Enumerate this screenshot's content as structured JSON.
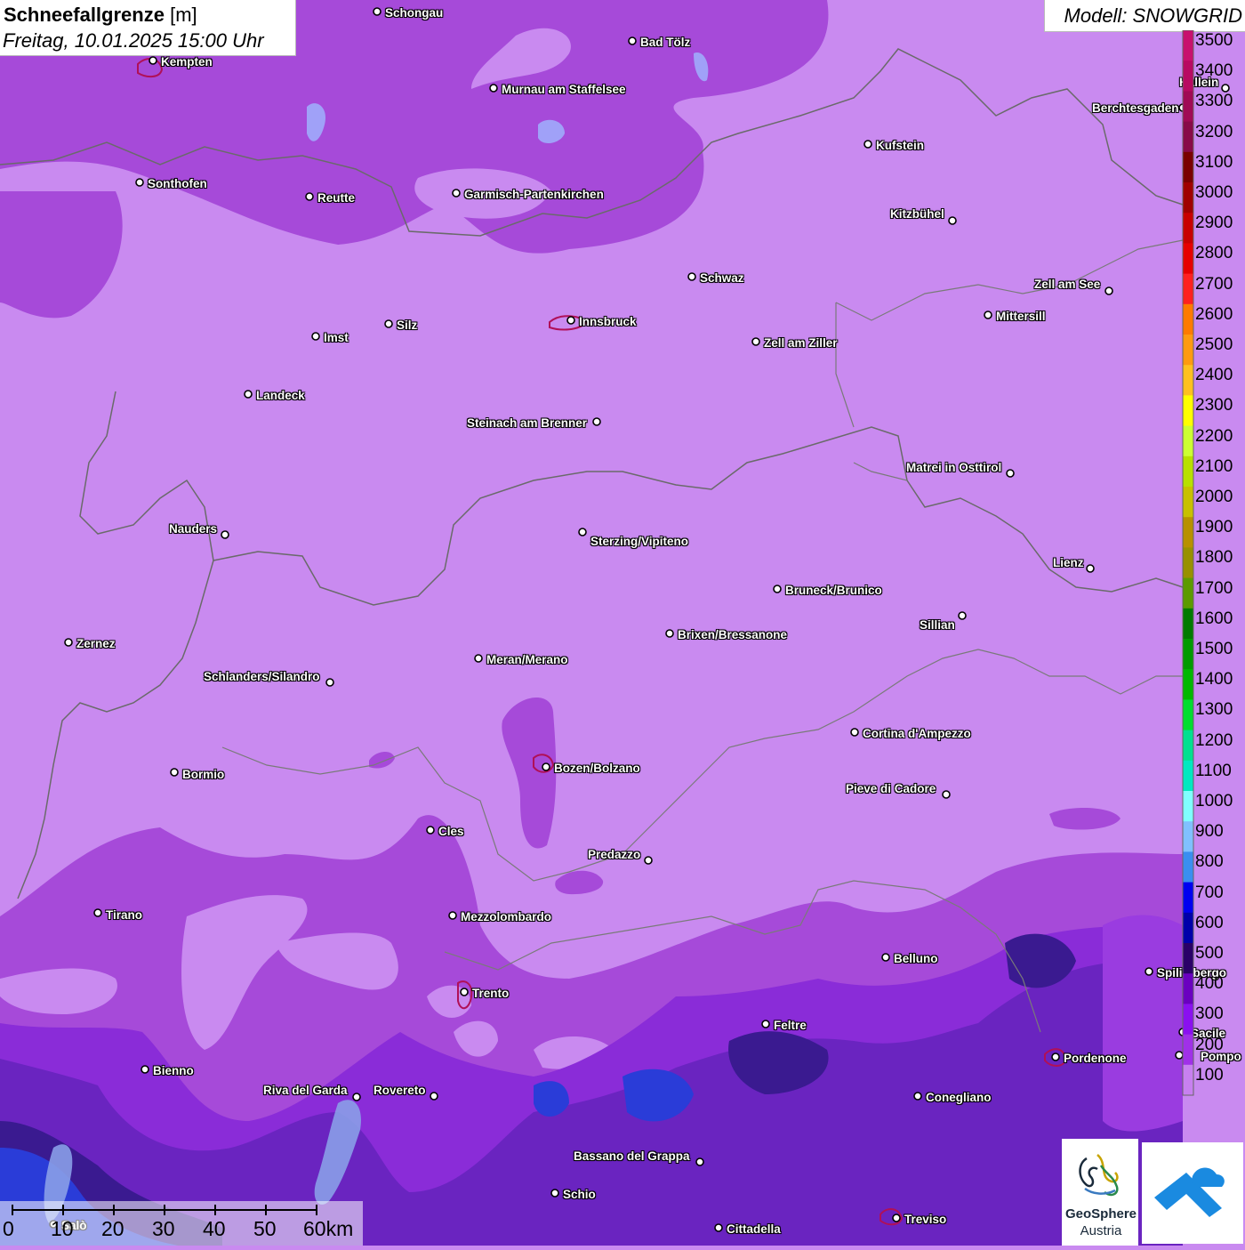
{
  "header": {
    "title": "Schneefallgrenze",
    "unit": "[m]",
    "datetime": "Freitag, 10.01.2025 15:00 Uhr",
    "model": "Modell: SNOWGRID"
  },
  "legend": {
    "levels": [
      {
        "value": "3500",
        "color": "#c8106e"
      },
      {
        "value": "3400",
        "color": "#b80a62"
      },
      {
        "value": "3300",
        "color": "#a00a55"
      },
      {
        "value": "3200",
        "color": "#880a48"
      },
      {
        "value": "3100",
        "color": "#7a0000"
      },
      {
        "value": "3000",
        "color": "#a00000"
      },
      {
        "value": "2900",
        "color": "#c80000"
      },
      {
        "value": "2800",
        "color": "#e60000"
      },
      {
        "value": "2700",
        "color": "#ff2020"
      },
      {
        "value": "2600",
        "color": "#ff7a00"
      },
      {
        "value": "2500",
        "color": "#ff9a10"
      },
      {
        "value": "2400",
        "color": "#ffc020"
      },
      {
        "value": "2300",
        "color": "#ffff00"
      },
      {
        "value": "2200",
        "color": "#ccff33"
      },
      {
        "value": "2100",
        "color": "#b8e000"
      },
      {
        "value": "2000",
        "color": "#c8c000"
      },
      {
        "value": "1900",
        "color": "#b89000"
      },
      {
        "value": "1800",
        "color": "#989000"
      },
      {
        "value": "1700",
        "color": "#5c9a00"
      },
      {
        "value": "1600",
        "color": "#007a00"
      },
      {
        "value": "1500",
        "color": "#009a00"
      },
      {
        "value": "1400",
        "color": "#00b800"
      },
      {
        "value": "1300",
        "color": "#00dd30"
      },
      {
        "value": "1200",
        "color": "#00e090"
      },
      {
        "value": "1100",
        "color": "#00e8c0"
      },
      {
        "value": "1000",
        "color": "#80ffff"
      },
      {
        "value": "900",
        "color": "#80c0ff"
      },
      {
        "value": "800",
        "color": "#3a8ef0"
      },
      {
        "value": "700",
        "color": "#0000f0"
      },
      {
        "value": "600",
        "color": "#0000aa"
      },
      {
        "value": "500",
        "color": "#2a0068"
      },
      {
        "value": "400",
        "color": "#6a00c0"
      },
      {
        "value": "300",
        "color": "#8a10f0"
      },
      {
        "value": "200",
        "color": "#a030e8"
      },
      {
        "value": "100",
        "color": "#c880f0"
      }
    ]
  },
  "cities": [
    {
      "name": "Schongau"
    },
    {
      "name": "Bad Tölz"
    },
    {
      "name": "Kempten"
    },
    {
      "name": "Murnau am Staffelsee"
    },
    {
      "name": "Hallein"
    },
    {
      "name": "Berchtesgaden"
    },
    {
      "name": "Kufstein"
    },
    {
      "name": "Sonthofen"
    },
    {
      "name": "Reutte"
    },
    {
      "name": "Garmisch-Partenkirchen"
    },
    {
      "name": "Kitzbühel"
    },
    {
      "name": "Schwaz"
    },
    {
      "name": "Zell am See"
    },
    {
      "name": "Mittersill"
    },
    {
      "name": "Innsbruck"
    },
    {
      "name": "Imst"
    },
    {
      "name": "Silz"
    },
    {
      "name": "Zell am Ziller"
    },
    {
      "name": "Landeck"
    },
    {
      "name": "Steinach am Brenner"
    },
    {
      "name": "Matrei in Osttirol"
    },
    {
      "name": "Nauders"
    },
    {
      "name": "Sterzing/Vipiteno"
    },
    {
      "name": "Lienz"
    },
    {
      "name": "Bruneck/Brunico"
    },
    {
      "name": "Sillian"
    },
    {
      "name": "Zernez"
    },
    {
      "name": "Brixen/Bressanone"
    },
    {
      "name": "Meran/Merano"
    },
    {
      "name": "Schlanders/Silandro"
    },
    {
      "name": "Cortina d'Ampezzo"
    },
    {
      "name": "Bozen/Bolzano"
    },
    {
      "name": "Bormio"
    },
    {
      "name": "Pieve di Cadore"
    },
    {
      "name": "Cles"
    },
    {
      "name": "Predazzo"
    },
    {
      "name": "Tirano"
    },
    {
      "name": "Mezzolombardo"
    },
    {
      "name": "Belluno"
    },
    {
      "name": "Spilimbergo"
    },
    {
      "name": "Trento"
    },
    {
      "name": "Feltre"
    },
    {
      "name": "Pordenone"
    },
    {
      "name": "Bienno"
    },
    {
      "name": "Riva del Garda"
    },
    {
      "name": "Rovereto"
    },
    {
      "name": "Conegliano"
    },
    {
      "name": "Bassano del Grappa"
    },
    {
      "name": "Schio"
    },
    {
      "name": "Treviso"
    },
    {
      "name": "Cittadella"
    },
    {
      "name": "Salò"
    },
    {
      "name": "Sacile"
    },
    {
      "name": "Pompo"
    }
  ],
  "scale": {
    "ticks": [
      "0",
      "10",
      "20",
      "30",
      "40",
      "50",
      "60km"
    ]
  },
  "logo": {
    "name": "GeoSphere",
    "sub": "Austria"
  },
  "colors": {
    "base_fill": "#c98af0",
    "snowline_100": "#c880f0",
    "snowline_200": "#a030e8",
    "snowline_300": "#8a10f0",
    "snowline_400": "#6a00c0",
    "snowline_500": "#2a0068",
    "snowline_700": "#0000f0",
    "border_line": "#6a6a6a",
    "lake_fill": "#9fb6ff"
  }
}
